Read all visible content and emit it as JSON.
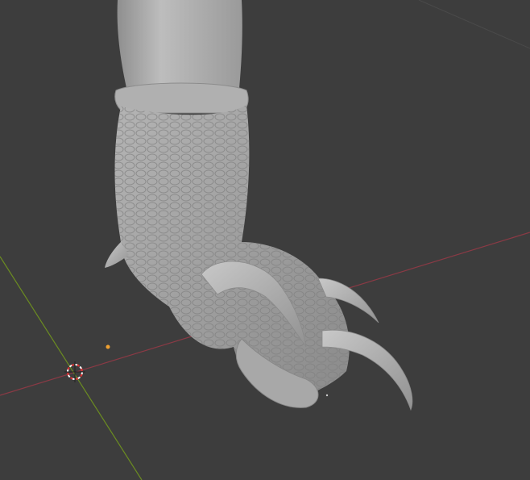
{
  "viewport": {
    "background_color": "#3d3d3d",
    "grid_line_color": "#4a4a4a",
    "x_axis_color": "#8a3a45",
    "y_axis_color": "#6b8c21"
  },
  "scene": {
    "object_name": "dragon-claw-foot-sculpt",
    "mesh_color": "#a9a9a9",
    "origin_point_color": "#f0a030",
    "cursor_icon": "3d-cursor-icon"
  }
}
